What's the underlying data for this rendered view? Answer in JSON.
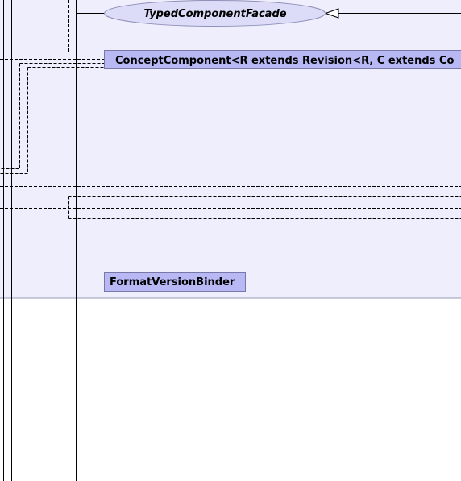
{
  "diagram": {
    "colors": {
      "package_fill": "#eeeefc",
      "package_border": "#9a9ab8",
      "class_fill": "#b7b8f4",
      "class_border": "#7878a8",
      "interface_fill": "#dcdcf8",
      "line": "#000000"
    },
    "nodes": {
      "typed_component_facade": {
        "label": "TypedComponentFacade",
        "kind": "interface"
      },
      "concept_component": {
        "label": "ConceptComponent<R extends Revision<R, C extends Co",
        "kind": "class"
      },
      "format_version_binder": {
        "label": "FormatVersionBinder",
        "kind": "class"
      }
    },
    "edges": [
      {
        "name": "realization-edge",
        "style": "solid",
        "arrow": "hollow-triangle"
      },
      {
        "name": "dependency-edge",
        "style": "dashed",
        "arrow": "none"
      }
    ]
  }
}
